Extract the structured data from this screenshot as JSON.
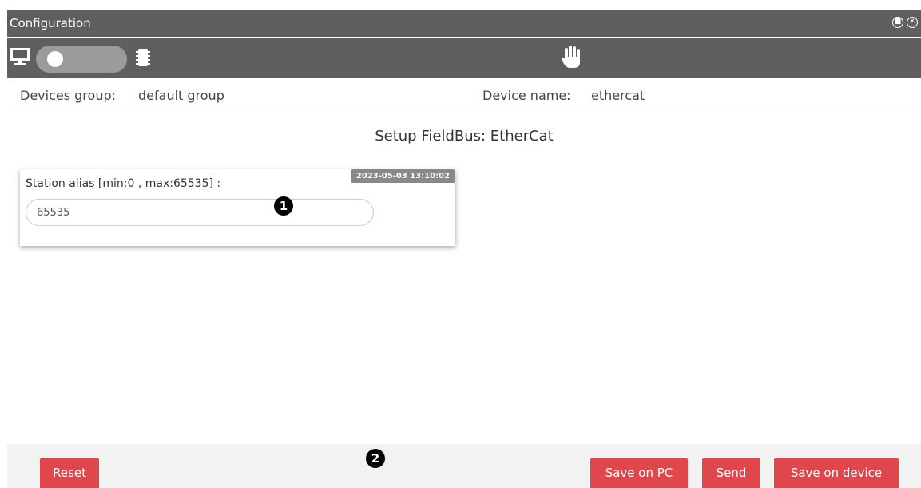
{
  "window": {
    "title": "Configuration"
  },
  "info": {
    "group_label": "Devices group:",
    "group_value": "default group",
    "device_label": "Device name:",
    "device_value": "ethercat"
  },
  "section": {
    "title": "Setup FieldBus: EtherCat"
  },
  "station_alias": {
    "label": "Station alias [min:0 , max:65535] :",
    "timestamp": "2023-05-03 13:10:02",
    "value": "65535"
  },
  "callouts": {
    "first": "1",
    "second": "2"
  },
  "footer": {
    "reset_label": "Reset",
    "save_pc_label": "Save on PC",
    "send_label": "Send",
    "save_device_label": "Save on device"
  },
  "colors": {
    "header_bg": "#5f5f5f",
    "button_red": "#e0474c",
    "toggle_track": "#9b9b9b"
  },
  "icons": {
    "monitor": "monitor-icon",
    "chip": "chip-icon",
    "hand": "hand-icon",
    "minimize": "circle-minimize-icon",
    "close": "circle-close-icon"
  }
}
